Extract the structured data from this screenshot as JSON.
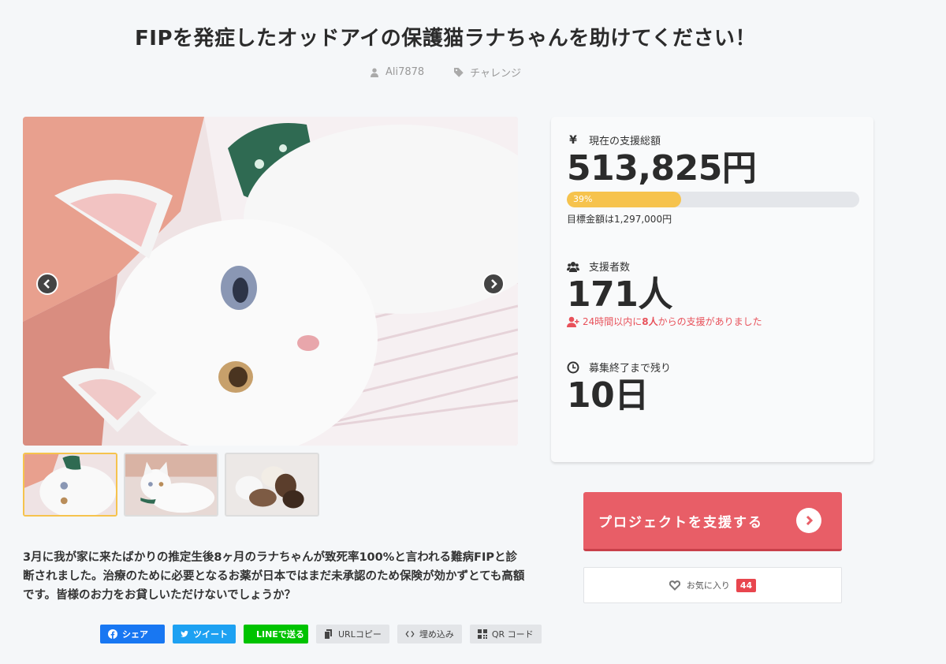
{
  "project": {
    "title": "FIPを発症したオッドアイの保護猫ラナちゃんを助けてください！",
    "author": "Ali7878",
    "category": "チャレンジ",
    "description": "3月に我が家に来たばかりの推定生後8ヶ月のラナちゃんが致死率100%と言われる難病FIPと診断されました。治療のために必要となるお薬が日本ではまだ未承認のため保険が効かずとても高額です。皆様のお力をお貸しいただけないでしょうか？"
  },
  "gallery": {
    "thumbnails": [
      "cat-photo-1",
      "cat-photo-2",
      "cat-photo-3"
    ],
    "active_index": 0
  },
  "stats": {
    "amount_label": "現在の支援総額",
    "amount_value": "513,825円",
    "progress_text": "39%",
    "progress_fraction": 0.39,
    "goal_text": "目標金額は1,297,000円",
    "supporters_label": "支援者数",
    "supporters_value": "171人",
    "recent_prefix": "24時間以内に",
    "recent_count": "8人",
    "recent_suffix": "からの支援がありました",
    "remaining_label": "募集終了まで残り",
    "remaining_value": "10日"
  },
  "actions": {
    "support_label": "プロジェクトを支援する",
    "favorite_label": "お気に入り",
    "favorite_count": "44"
  },
  "share": {
    "facebook": "シェア",
    "twitter": "ツイート",
    "line": "LINEで送る",
    "url_copy": "URLコピー",
    "embed": "埋め込み",
    "qr": "QR コード"
  },
  "colors": {
    "accent": "#e85e67",
    "progress": "#f6c34d",
    "alert": "#e8515a",
    "facebook": "#1877f2",
    "twitter": "#1da1f2",
    "line": "#00c300"
  },
  "icons": {
    "author": "user-icon",
    "category": "tag-icon",
    "amount": "yen-icon",
    "supporters": "users-icon",
    "remaining": "clock-icon",
    "recent": "user-plus-icon",
    "favorite": "heart-icon"
  }
}
